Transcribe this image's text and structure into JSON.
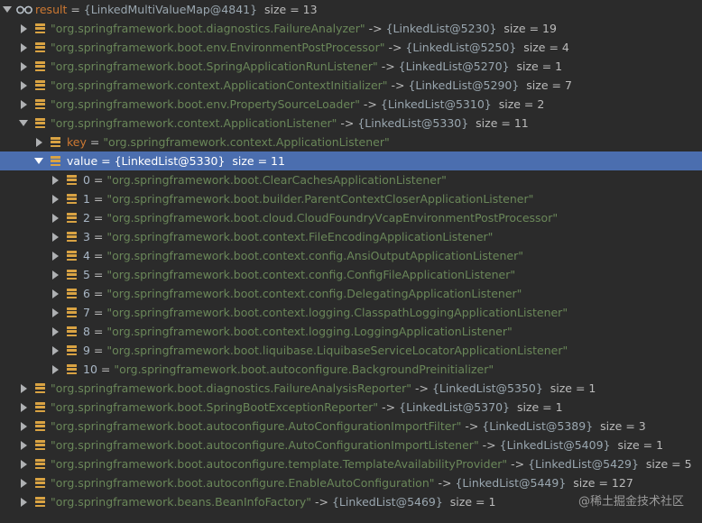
{
  "root": {
    "name": "result",
    "eq": " = ",
    "ref": "{LinkedMultiValueMap@4841}",
    "size": "size = 13"
  },
  "entries_before": [
    {
      "key": "\"org.springframework.boot.diagnostics.FailureAnalyzer\"",
      "arrow": " -> ",
      "ref": "{LinkedList@5230}",
      "size": "size = 19"
    },
    {
      "key": "\"org.springframework.boot.env.EnvironmentPostProcessor\"",
      "arrow": " -> ",
      "ref": "{LinkedList@5250}",
      "size": "size = 4"
    },
    {
      "key": "\"org.springframework.boot.SpringApplicationRunListener\"",
      "arrow": " -> ",
      "ref": "{LinkedList@5270}",
      "size": "size = 1"
    },
    {
      "key": "\"org.springframework.context.ApplicationContextInitializer\"",
      "arrow": " -> ",
      "ref": "{LinkedList@5290}",
      "size": "size = 7"
    },
    {
      "key": "\"org.springframework.boot.env.PropertySourceLoader\"",
      "arrow": " -> ",
      "ref": "{LinkedList@5310}",
      "size": "size = 2"
    }
  ],
  "expanded_entry": {
    "key": "\"org.springframework.context.ApplicationListener\"",
    "arrow": " -> ",
    "ref": "{LinkedList@5330}",
    "size": "size = 11",
    "key_field": {
      "name": "key",
      "eq": " = ",
      "value": "\"org.springframework.context.ApplicationListener\""
    },
    "value_field": {
      "name": "value",
      "eq": " = ",
      "ref": "{LinkedList@5330}",
      "size": "size = 11"
    },
    "items": [
      {
        "idx": "0",
        "eq": " = ",
        "value": "\"org.springframework.boot.ClearCachesApplicationListener\""
      },
      {
        "idx": "1",
        "eq": " = ",
        "value": "\"org.springframework.boot.builder.ParentContextCloserApplicationListener\""
      },
      {
        "idx": "2",
        "eq": " = ",
        "value": "\"org.springframework.boot.cloud.CloudFoundryVcapEnvironmentPostProcessor\""
      },
      {
        "idx": "3",
        "eq": " = ",
        "value": "\"org.springframework.boot.context.FileEncodingApplicationListener\""
      },
      {
        "idx": "4",
        "eq": " = ",
        "value": "\"org.springframework.boot.context.config.AnsiOutputApplicationListener\""
      },
      {
        "idx": "5",
        "eq": " = ",
        "value": "\"org.springframework.boot.context.config.ConfigFileApplicationListener\""
      },
      {
        "idx": "6",
        "eq": " = ",
        "value": "\"org.springframework.boot.context.config.DelegatingApplicationListener\""
      },
      {
        "idx": "7",
        "eq": " = ",
        "value": "\"org.springframework.boot.context.logging.ClasspathLoggingApplicationListener\""
      },
      {
        "idx": "8",
        "eq": " = ",
        "value": "\"org.springframework.boot.context.logging.LoggingApplicationListener\""
      },
      {
        "idx": "9",
        "eq": " = ",
        "value": "\"org.springframework.boot.liquibase.LiquibaseServiceLocatorApplicationListener\""
      },
      {
        "idx": "10",
        "eq": " = ",
        "value": "\"org.springframework.boot.autoconfigure.BackgroundPreinitializer\""
      }
    ]
  },
  "entries_after": [
    {
      "key": "\"org.springframework.boot.diagnostics.FailureAnalysisReporter\"",
      "arrow": " -> ",
      "ref": "{LinkedList@5350}",
      "size": "size = 1"
    },
    {
      "key": "\"org.springframework.boot.SpringBootExceptionReporter\"",
      "arrow": " -> ",
      "ref": "{LinkedList@5370}",
      "size": "size = 1"
    },
    {
      "key": "\"org.springframework.boot.autoconfigure.AutoConfigurationImportFilter\"",
      "arrow": " -> ",
      "ref": "{LinkedList@5389}",
      "size": "size = 3"
    },
    {
      "key": "\"org.springframework.boot.autoconfigure.AutoConfigurationImportListener\"",
      "arrow": " -> ",
      "ref": "{LinkedList@5409}",
      "size": "size = 1"
    },
    {
      "key": "\"org.springframework.boot.autoconfigure.template.TemplateAvailabilityProvider\"",
      "arrow": " -> ",
      "ref": "{LinkedList@5429}",
      "size": "size = 5"
    },
    {
      "key": "\"org.springframework.boot.autoconfigure.EnableAutoConfiguration\"",
      "arrow": " -> ",
      "ref": "{LinkedList@5449}",
      "size": "size = 127"
    },
    {
      "key": "\"org.springframework.beans.BeanInfoFactory\"",
      "arrow": " -> ",
      "ref": "{LinkedList@5469}",
      "size": "size = 1"
    }
  ],
  "watermark": "@稀土掘金技术社区",
  "icons": {
    "watch": "glasses-watch-icon",
    "field": "field-list-icon",
    "expanded": "chevron-down-icon",
    "collapsed": "chevron-right-icon"
  },
  "colors": {
    "background": "#2b2b2b",
    "selection": "#4b6eaf",
    "string": "#6a8759",
    "field_name": "#cc7832",
    "field_icon": "#d9a343"
  }
}
